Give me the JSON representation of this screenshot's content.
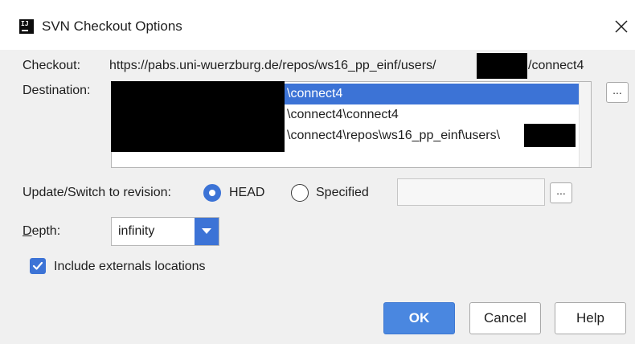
{
  "window": {
    "title": "SVN Checkout Options",
    "app_icon_text": "IJ"
  },
  "checkout": {
    "label": "Checkout:",
    "url_prefix": "https://pabs.uni-wuerzburg.de/repos/ws16_pp_einf/users/",
    "url_suffix": "/connect4"
  },
  "destination": {
    "label": "Destination:",
    "items": [
      {
        "text": "\\connect4",
        "selected": true
      },
      {
        "text": "\\connect4\\connect4",
        "selected": false
      },
      {
        "text": "\\connect4\\repos\\ws16_pp_einf\\users\\",
        "selected": false
      }
    ],
    "browse_label": "..."
  },
  "revision": {
    "label": "Update/Switch to revision:",
    "head_label": "HEAD",
    "specified_label": "Specified",
    "selected": "HEAD",
    "specified_value": "",
    "browse_label": "..."
  },
  "depth": {
    "label_first": "D",
    "label_rest": "epth:",
    "value": "infinity"
  },
  "externals": {
    "label": "Include externals locations",
    "checked": true
  },
  "buttons": {
    "ok": "OK",
    "cancel": "Cancel",
    "help": "Help"
  },
  "colors": {
    "accent": "#3c73d6",
    "primary_button": "#4a87e0",
    "dialog_bg": "#f0f0f0",
    "redaction": "#000000"
  }
}
